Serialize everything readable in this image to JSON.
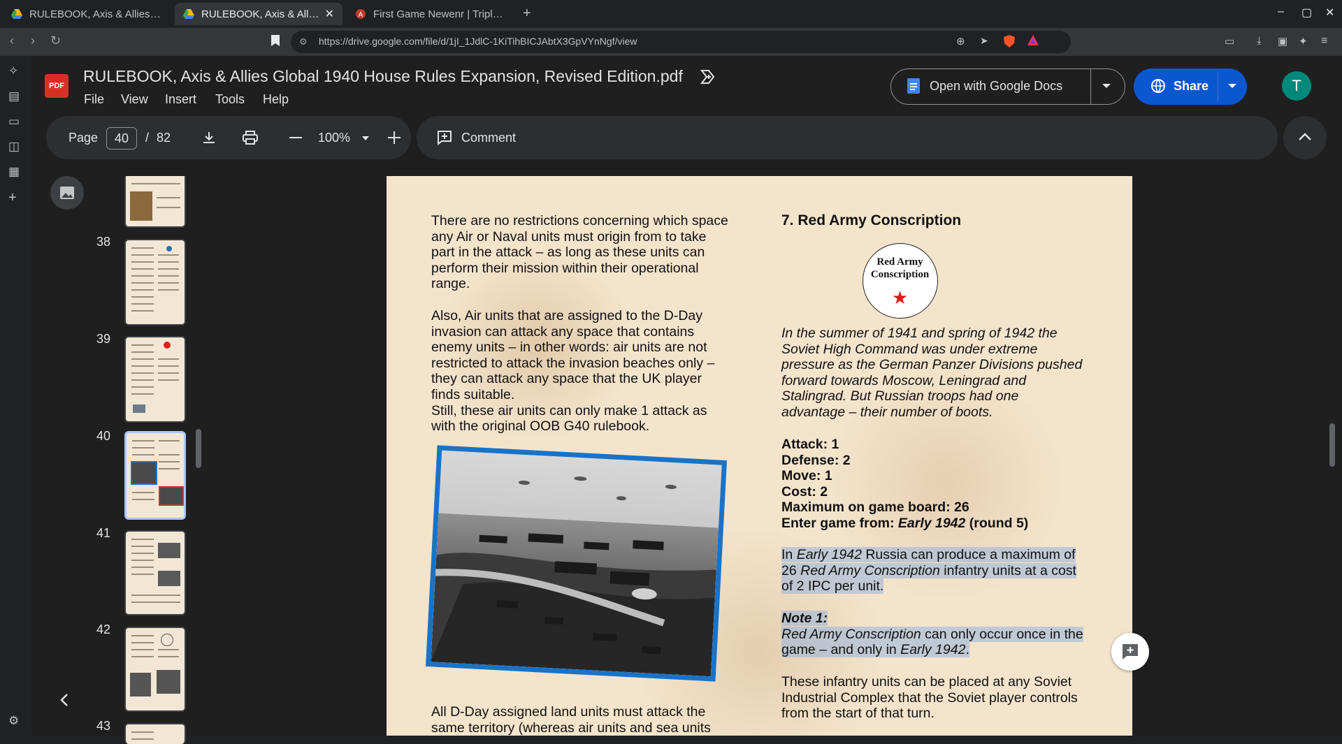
{
  "browser": {
    "tabs": [
      {
        "title": "RULEBOOK, Axis & Allies Glob",
        "active": false
      },
      {
        "title": "RULEBOOK, Axis & Allies G",
        "active": true
      },
      {
        "title": "First Game Newenr | TripleA F",
        "active": false
      }
    ],
    "new_tab": "+",
    "url": "https://drive.google.com/file/d/1jI_1JdlC-1KiTihBICJAbtX3GpVYnNgf/view",
    "controls": {
      "minimize": "–",
      "maximize": "▢",
      "close": "✕"
    }
  },
  "app": {
    "file_badge": "PDF",
    "doc_title": "RULEBOOK, Axis & Allies Global 1940 House Rules Expansion, Revised Edition.pdf",
    "menu": [
      "File",
      "View",
      "Insert",
      "Tools",
      "Help"
    ],
    "open_with": "Open with Google Docs",
    "share": "Share",
    "avatar_initial": "T"
  },
  "toolbar": {
    "page_label": "Page",
    "page_current": "40",
    "page_sep": "/",
    "page_total": "82",
    "zoom": "100%",
    "comment": "Comment"
  },
  "thumbnails": [
    {
      "number": "38"
    },
    {
      "number": "39"
    },
    {
      "number": "40",
      "selected": true
    },
    {
      "number": "41"
    },
    {
      "number": "42"
    },
    {
      "number": "43"
    }
  ],
  "document": {
    "left_col": {
      "p1": [
        "There are no restrictions concerning which space",
        "any Air or Naval units must origin from to take",
        "part in the attack – as long as these units can",
        "perform their mission within their operational",
        "range."
      ],
      "p2": [
        "Also, Air units that are assigned to the D-Day",
        "invasion can attack any space that contains",
        "enemy units – in other words: air units are not",
        "restricted to attack the invasion beaches only –",
        "they can attack any space that the UK player",
        "finds suitable.",
        "Still, these air units can only make 1 attack as",
        "with the original OOB G40 rulebook."
      ],
      "p3": [
        "All D-Day assigned land units must attack the",
        "same territory (whereas air units and sea units"
      ]
    },
    "right_col": {
      "heading": "7. Red Army Conscription",
      "badge_line1": "Red Army",
      "badge_line2": "Conscription",
      "badge_star": "★",
      "intro": [
        "In the summer of 1941 and spring of 1942 the",
        "Soviet High Command was under extreme",
        "pressure as the German Panzer Divisions pushed",
        "forward towards Moscow, Leningrad and",
        "Stalingrad. But Russian troops had one",
        "advantage – their number of boots."
      ],
      "stats": {
        "attack": "Attack: 1",
        "defense": "Defense: 2",
        "move": "Move: 1",
        "cost": "Cost: 2",
        "max": "Maximum on game board: 26",
        "enter_prefix": "Enter game from: ",
        "enter_italic": "Early 1942",
        "enter_suffix": " (round 5)"
      },
      "para_a": {
        "l1_a": "In ",
        "l1_b": "Early 1942",
        "l1_c": " Russia can produce a maximum of",
        "l2_a": "26 ",
        "l2_b": "Red Army Conscription",
        "l2_c": " infantry units at a cost",
        "l3": "of 2 IPC per unit."
      },
      "note_title": "Note 1:",
      "note": {
        "l1_a": "Red Army Conscription",
        "l1_b": " can only occur once in the",
        "l2_a": "game – and only in ",
        "l2_b": "Early 1942",
        "l2_c": "."
      },
      "para_c": [
        "These infantry units can be placed at any Soviet",
        "Industrial Complex that the Soviet player controls",
        "from the start of that turn."
      ]
    }
  }
}
